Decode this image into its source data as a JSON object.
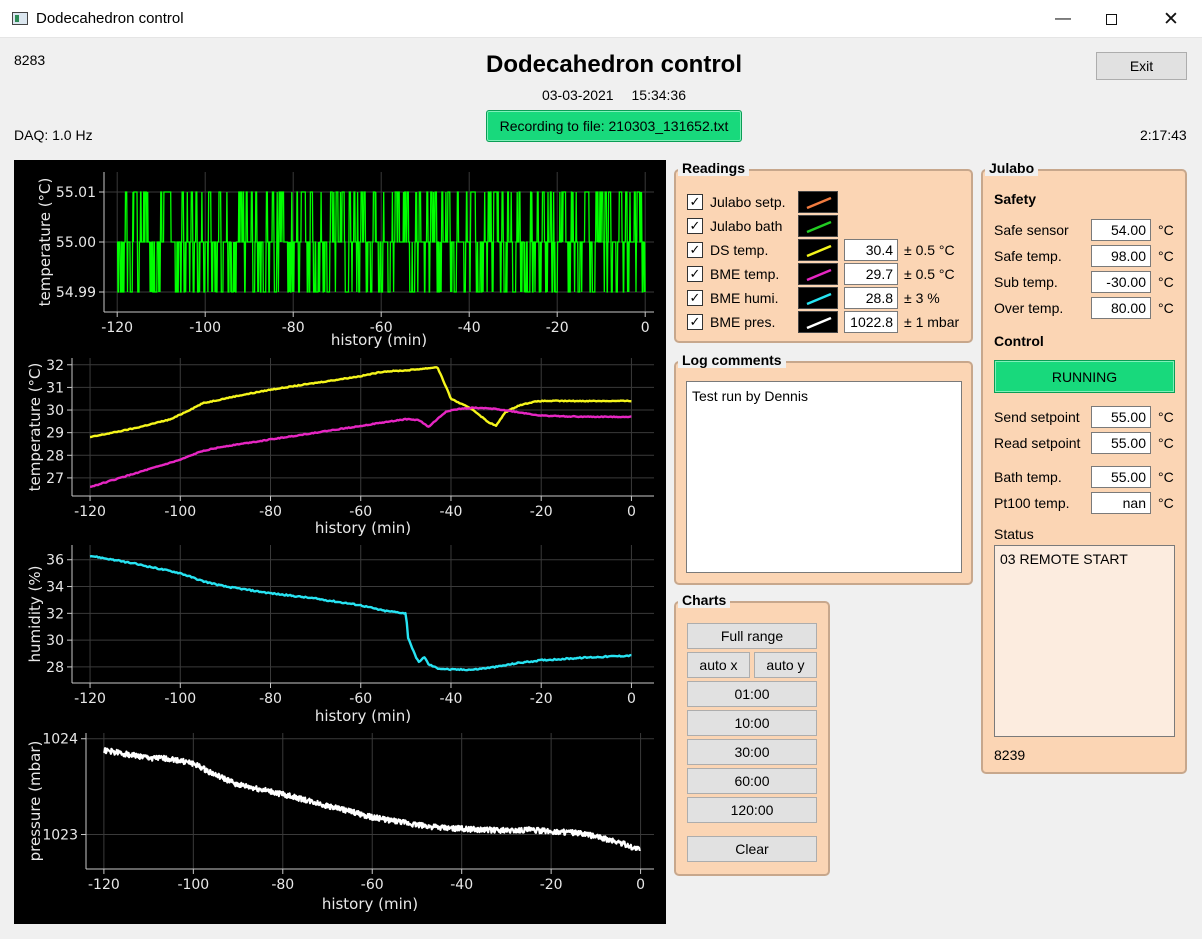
{
  "window": {
    "title": "Dodecahedron control"
  },
  "header": {
    "counter": "8283",
    "title": "Dodecahedron control",
    "date": "03-03-2021",
    "time": "15:34:36",
    "recording": "Recording to file: 210303_131652.txt",
    "exit_label": "Exit",
    "daq_rate": "DAQ: 1.0 Hz",
    "elapsed": "2:17:43"
  },
  "readings": {
    "title": "Readings",
    "rows": [
      {
        "label": "Julabo setp.",
        "checked": true,
        "color": "#f07b3f",
        "value": "",
        "uncertainty": ""
      },
      {
        "label": "Julabo bath",
        "checked": true,
        "color": "#22cc22",
        "value": "",
        "uncertainty": ""
      },
      {
        "label": "DS temp.",
        "checked": true,
        "color": "#f5f51c",
        "value": "30.4",
        "uncertainty": "± 0.5 °C"
      },
      {
        "label": "BME temp.",
        "checked": true,
        "color": "#e626c2",
        "value": "29.7",
        "uncertainty": "± 0.5 °C"
      },
      {
        "label": "BME humi.",
        "checked": true,
        "color": "#27e3f2",
        "value": "28.8",
        "uncertainty": "± 3 %"
      },
      {
        "label": "BME pres.",
        "checked": true,
        "color": "#ffffff",
        "value": "1022.8",
        "uncertainty": "± 1 mbar"
      }
    ]
  },
  "log": {
    "title": "Log comments",
    "text": "Test run by Dennis"
  },
  "charts_controls": {
    "title": "Charts",
    "full_range": "Full range",
    "auto_x": "auto x",
    "auto_y": "auto y",
    "ranges": [
      "01:00",
      "10:00",
      "30:00",
      "60:00",
      "120:00"
    ],
    "clear": "Clear"
  },
  "julabo": {
    "title": "Julabo",
    "safety_title": "Safety",
    "safety": [
      {
        "label": "Safe sensor",
        "value": "54.00",
        "unit": "°C"
      },
      {
        "label": "Safe temp.",
        "value": "98.00",
        "unit": "°C"
      },
      {
        "label": "Sub temp.",
        "value": "-30.00",
        "unit": "°C"
      },
      {
        "label": "Over temp.",
        "value": "80.00",
        "unit": "°C"
      }
    ],
    "control_title": "Control",
    "running_label": "RUNNING",
    "setpoints": [
      {
        "label": "Send setpoint",
        "value": "55.00",
        "unit": "°C"
      },
      {
        "label": "Read setpoint",
        "value": "55.00",
        "unit": "°C"
      }
    ],
    "temps": [
      {
        "label": "Bath temp.",
        "value": "55.00",
        "unit": "°C"
      },
      {
        "label": "Pt100 temp.",
        "value": "nan",
        "unit": "°C"
      }
    ],
    "status_title": "Status",
    "status_text": "03 REMOTE START",
    "counter": "8239"
  },
  "chart_data": [
    {
      "type": "line",
      "xlabel": "history (min)",
      "ylabel": "temperature (°C)",
      "xlim": [
        -123,
        2
      ],
      "ylim": [
        54.986,
        55.014
      ],
      "xticks": [
        -120,
        -100,
        -80,
        -60,
        -40,
        -20,
        0
      ],
      "yticks": [
        55.01,
        55.0,
        54.99
      ],
      "ytick_labels": [
        "55.01",
        "55.00",
        "54.99"
      ],
      "grid": true,
      "series": [
        {
          "color": "#00ff00",
          "kind": "toggle",
          "x_range": [
            -120,
            0
          ],
          "levels": [
            54.99,
            55.0,
            55.01
          ]
        }
      ]
    },
    {
      "type": "line",
      "xlabel": "history (min)",
      "ylabel": "temperature (°C)",
      "xlim": [
        -124,
        5
      ],
      "ylim": [
        26.2,
        32.3
      ],
      "xticks": [
        -120,
        -100,
        -80,
        -60,
        -40,
        -20,
        0
      ],
      "yticks": [
        32,
        31,
        30,
        29,
        28,
        27
      ],
      "ytick_labels": [
        "32",
        "31",
        "30",
        "29",
        "28",
        "27"
      ],
      "grid": true,
      "series": [
        {
          "color": "#f5f51c",
          "x": [
            -120,
            -110,
            -102,
            -98,
            -95,
            -88,
            -80,
            -70,
            -60,
            -55,
            -50,
            -45,
            -43,
            -40,
            -35,
            -32,
            -30,
            -28,
            -25,
            -22,
            -20,
            -10,
            0
          ],
          "y": [
            28.8,
            29.2,
            29.6,
            30.0,
            30.3,
            30.6,
            30.9,
            31.2,
            31.5,
            31.7,
            31.75,
            31.85,
            31.9,
            30.5,
            30.0,
            29.5,
            29.3,
            29.9,
            30.2,
            30.35,
            30.4,
            30.4,
            30.4
          ]
        },
        {
          "color": "#e626c2",
          "x": [
            -120,
            -110,
            -100,
            -95,
            -90,
            -80,
            -70,
            -60,
            -55,
            -50,
            -47,
            -45,
            -43,
            -41,
            -38,
            -35,
            -30,
            -25,
            -20,
            -10,
            0
          ],
          "y": [
            26.6,
            27.2,
            27.8,
            28.2,
            28.4,
            28.7,
            29.0,
            29.3,
            29.45,
            29.6,
            29.55,
            29.25,
            29.6,
            29.95,
            30.05,
            30.1,
            30.05,
            29.9,
            29.75,
            29.7,
            29.7
          ]
        }
      ]
    },
    {
      "type": "line",
      "xlabel": "history (min)",
      "ylabel": "humidity (%)",
      "xlim": [
        -124,
        5
      ],
      "ylim": [
        26.8,
        37.1
      ],
      "xticks": [
        -120,
        -100,
        -80,
        -60,
        -40,
        -20,
        0
      ],
      "yticks": [
        36,
        34,
        32,
        30,
        28
      ],
      "ytick_labels": [
        "36",
        "34",
        "32",
        "30",
        "28"
      ],
      "grid": true,
      "series": [
        {
          "color": "#27e3f2",
          "x": [
            -120,
            -110,
            -100,
            -95,
            -90,
            -80,
            -70,
            -60,
            -55,
            -50,
            -49.5,
            -48,
            -47,
            -46,
            -45,
            -43,
            -40,
            -35,
            -30,
            -25,
            -20,
            -10,
            0
          ],
          "y": [
            36.3,
            35.7,
            35.0,
            34.4,
            34.0,
            33.5,
            33.1,
            32.6,
            32.2,
            32.0,
            30.2,
            28.9,
            28.3,
            28.8,
            28.2,
            27.9,
            27.8,
            27.8,
            28.0,
            28.3,
            28.5,
            28.7,
            28.85
          ]
        }
      ]
    },
    {
      "type": "line",
      "xlabel": "history (min)",
      "ylabel": "pressure (mbar)",
      "xlim": [
        -124,
        3
      ],
      "ylim": [
        1022.64,
        1024.06
      ],
      "xticks": [
        -120,
        -100,
        -80,
        -60,
        -40,
        -20,
        0
      ],
      "yticks": [
        1024,
        1023
      ],
      "ytick_labels": [
        "1024",
        "1023"
      ],
      "grid": true,
      "series": [
        {
          "color": "#ffffff",
          "x": [
            -120,
            -115,
            -110,
            -105,
            -100,
            -95,
            -90,
            -85,
            -80,
            -75,
            -70,
            -65,
            -60,
            -55,
            -50,
            -45,
            -40,
            -35,
            -30,
            -25,
            -20,
            -15,
            -10,
            -5,
            0
          ],
          "y": [
            1023.88,
            1023.84,
            1023.8,
            1023.79,
            1023.74,
            1023.62,
            1023.52,
            1023.47,
            1023.42,
            1023.36,
            1023.3,
            1023.24,
            1023.18,
            1023.14,
            1023.1,
            1023.07,
            1023.06,
            1023.05,
            1023.04,
            1023.05,
            1023.03,
            1023.02,
            1022.98,
            1022.92,
            1022.84
          ]
        }
      ]
    }
  ]
}
